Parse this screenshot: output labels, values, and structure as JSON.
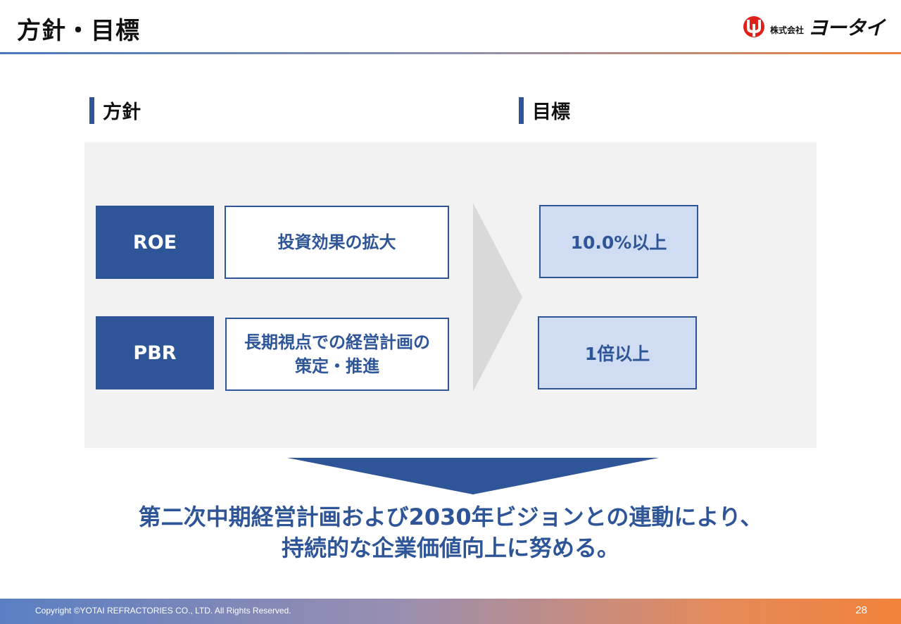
{
  "header": {
    "title": "方針・目標",
    "logo": {
      "small_text": "株式会社",
      "name": "ヨータイ"
    }
  },
  "sections": {
    "policy_heading": "方針",
    "target_heading": "目標"
  },
  "rows": [
    {
      "label": "ROE",
      "policy": "投資効果の拡大",
      "target": "10.0%以上"
    },
    {
      "label": "PBR",
      "policy_lines": [
        "長期視点での経営計画の",
        "策定・推進"
      ],
      "target": "1倍以上"
    }
  ],
  "conclusion": {
    "line1": "第二次中期経営計画および2030年ビジョンとの連動により、",
    "line2": "持続的な企業価値向上に努める。"
  },
  "footer": {
    "copyright": "Copyright ©YOTAI REFRACTORIES CO., LTD. All Rights Reserved.",
    "page_number": "28"
  },
  "colors": {
    "primary_blue": "#2e5597",
    "light_blue": "#cfdcf1",
    "panel_gray": "#f2f2f2",
    "accent_orange": "#f0823a",
    "logo_red": "#e0201b"
  }
}
